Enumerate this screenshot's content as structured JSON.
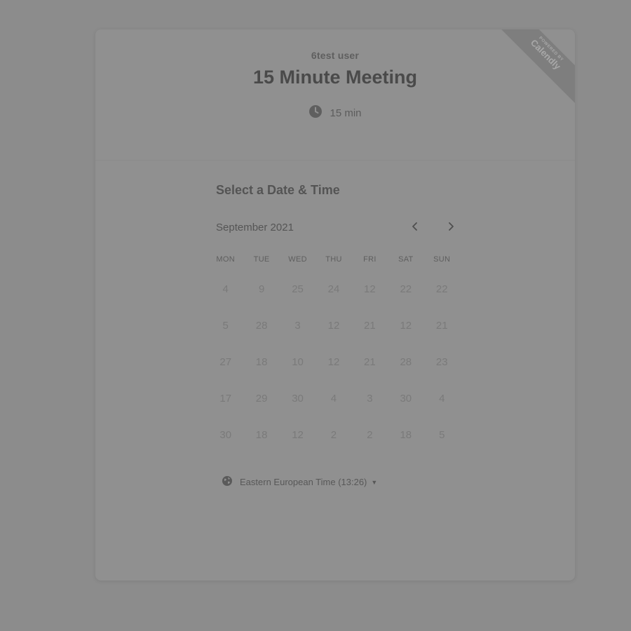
{
  "header": {
    "user_name": "6test user",
    "event_title": "15 Minute Meeting",
    "duration": "15 min"
  },
  "ribbon": {
    "top_text": "POWERED BY",
    "brand": "Calendly"
  },
  "scheduler": {
    "section_title": "Select a Date & Time",
    "month_label": "September 2021",
    "weekdays": [
      "MON",
      "TUE",
      "WED",
      "THU",
      "FRI",
      "SAT",
      "SUN"
    ],
    "weeks": [
      [
        "4",
        "9",
        "25",
        "24",
        "12",
        "22",
        "22"
      ],
      [
        "5",
        "28",
        "3",
        "12",
        "21",
        "12",
        "21"
      ],
      [
        "27",
        "18",
        "10",
        "12",
        "21",
        "28",
        "23"
      ],
      [
        "17",
        "29",
        "30",
        "4",
        "3",
        "30",
        "4"
      ],
      [
        "30",
        "18",
        "12",
        "2",
        "2",
        "18",
        "5"
      ]
    ]
  },
  "timezone": {
    "label": "Eastern European Time (13:26)"
  },
  "icons": {
    "clock": "clock-icon",
    "globe": "globe-icon",
    "prev": "chevron-left-icon",
    "next": "chevron-right-icon",
    "caret": "caret-down-icon"
  },
  "colors": {
    "page_background": "#8c8c8c",
    "card_background": "#909090",
    "title_text": "#4a4a4a",
    "day_text": "#7a7a7a",
    "ribbon": "#7e7e7e"
  }
}
